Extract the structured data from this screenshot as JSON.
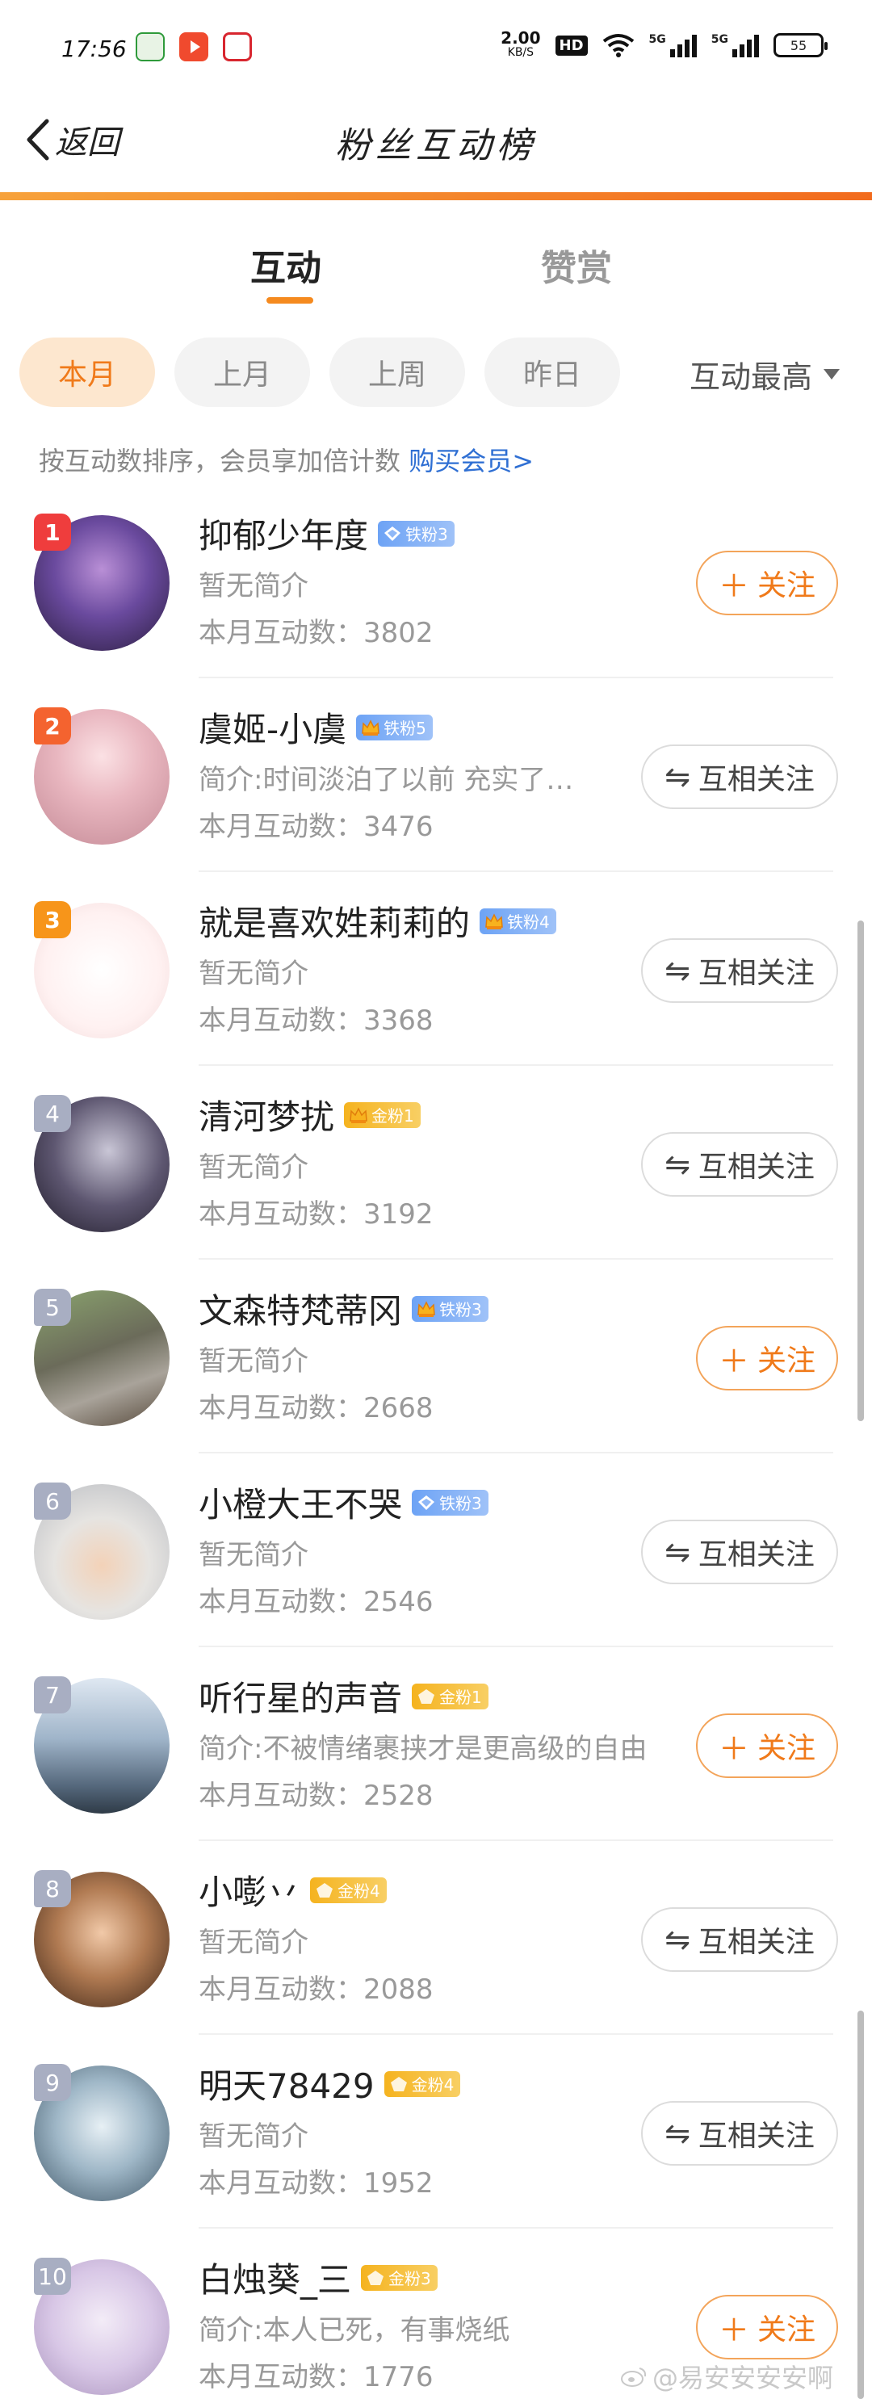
{
  "status_bar": {
    "time": "17:56",
    "net_speed_value": "2.00",
    "net_speed_unit": "KB/S",
    "hd_label": "HD",
    "sim1_label": "5G",
    "sim2_label": "5G",
    "battery": "55",
    "icons": [
      "wifi-icon",
      "signal-icon",
      "signal-icon",
      "battery-icon"
    ]
  },
  "nav": {
    "back_label": "返回",
    "title": "粉丝互动榜"
  },
  "tabs": {
    "active": "互动",
    "inactive": "赞赏"
  },
  "filters": {
    "chips": [
      "本月",
      "上月",
      "上周",
      "昨日"
    ],
    "selected_index": 0,
    "sort_label": "互动最高"
  },
  "hint": {
    "text": "按互动数排序，会员享加倍计数 ",
    "link": "购买会员>"
  },
  "colors": {
    "accent": "#f58a1f",
    "link": "#2f6fd3",
    "tie_badge": "#6da3f5",
    "jin_badge": "#f5b31f"
  },
  "rows": [
    {
      "rank": "1",
      "name": "抑郁少年度",
      "badge_text": "铁粉3",
      "badge_type": "tie",
      "badge_icon": "diamond-icon",
      "intro": "暂无简介",
      "count": "本月互动数：3802",
      "button": "关注",
      "button_type": "follow"
    },
    {
      "rank": "2",
      "name": "虞姬-小虞",
      "badge_text": "铁粉5",
      "badge_type": "tie",
      "badge_icon": "crown-icon",
      "intro": "简介:时间淡泊了以前 充实了…",
      "count": "本月互动数：3476",
      "button": "互相关注",
      "button_type": "mutual"
    },
    {
      "rank": "3",
      "name": "就是喜欢姓莉莉的",
      "badge_text": "铁粉4",
      "badge_type": "tie",
      "badge_icon": "crown-icon",
      "intro": "暂无简介",
      "count": "本月互动数：3368",
      "button": "互相关注",
      "button_type": "mutual"
    },
    {
      "rank": "4",
      "name": "清河梦扰",
      "badge_text": "金粉1",
      "badge_type": "jin",
      "badge_icon": "crown-icon",
      "intro": "暂无简介",
      "count": "本月互动数：3192",
      "button": "互相关注",
      "button_type": "mutual"
    },
    {
      "rank": "5",
      "name": "文森特梵蒂冈",
      "badge_text": "铁粉3",
      "badge_type": "tie",
      "badge_icon": "crown-icon",
      "intro": "暂无简介",
      "count": "本月互动数：2668",
      "button": "关注",
      "button_type": "follow"
    },
    {
      "rank": "6",
      "name": "小橙大王不哭",
      "badge_text": "铁粉3",
      "badge_type": "tie",
      "badge_icon": "diamond-icon",
      "intro": "暂无简介",
      "count": "本月互动数：2546",
      "button": "互相关注",
      "button_type": "mutual"
    },
    {
      "rank": "7",
      "name": "听行星的声音",
      "badge_text": "金粉1",
      "badge_type": "jin",
      "badge_icon": "pentagon-icon",
      "intro": "简介:不被情绪裹挟才是更高级的自由",
      "count": "本月互动数：2528",
      "button": "关注",
      "button_type": "follow"
    },
    {
      "rank": "8",
      "name": "小嘭丷",
      "badge_text": "金粉4",
      "badge_type": "jin",
      "badge_icon": "pentagon-icon",
      "intro": "暂无简介",
      "count": "本月互动数：2088",
      "button": "互相关注",
      "button_type": "mutual"
    },
    {
      "rank": "9",
      "name": "明天78429",
      "badge_text": "金粉4",
      "badge_type": "jin",
      "badge_icon": "pentagon-icon",
      "intro": "暂无简介",
      "count": "本月互动数：1952",
      "button": "互相关注",
      "button_type": "mutual"
    },
    {
      "rank": "10",
      "name": "白烛葵_三",
      "badge_text": "金粉3",
      "badge_type": "jin",
      "badge_icon": "pentagon-icon",
      "intro": "简介:本人已死，有事烧纸",
      "count": "本月互动数：1776",
      "button": "关注",
      "button_type": "follow"
    }
  ],
  "watermark": "@易安安安安啊"
}
